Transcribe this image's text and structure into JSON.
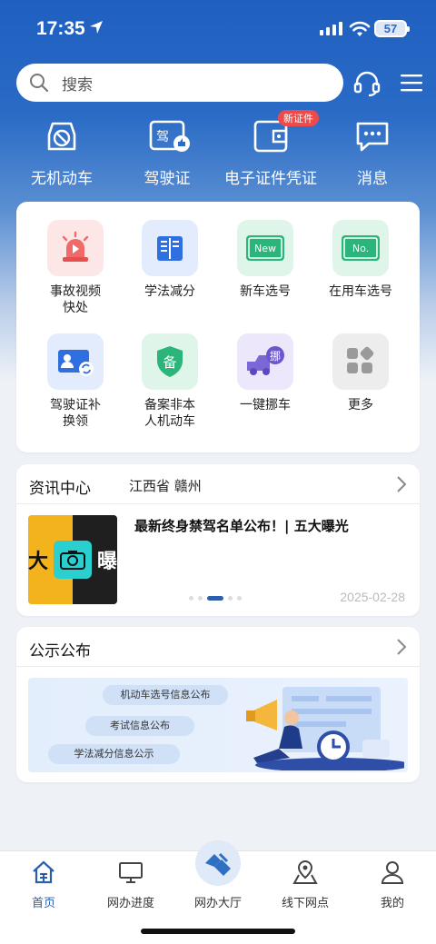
{
  "status": {
    "time": "17:35",
    "battery": "57"
  },
  "search": {
    "placeholder": "搜索"
  },
  "quick": [
    {
      "label": "无机动车"
    },
    {
      "label": "驾驶证"
    },
    {
      "label": "电子证件凭证",
      "badge": "新证件"
    },
    {
      "label": "消息"
    }
  ],
  "services": [
    {
      "label": "事故视频快处",
      "icon": "alarm-icon"
    },
    {
      "label": "学法减分",
      "icon": "book-icon"
    },
    {
      "label": "新车选号",
      "icon": "new-plate-icon",
      "glyph": "New"
    },
    {
      "label": "在用车选号",
      "icon": "plate-icon",
      "glyph": "No."
    },
    {
      "label": "驾驶证补换领",
      "icon": "license-renew-icon"
    },
    {
      "label": "备案非本人机动车",
      "icon": "shield-icon",
      "glyph": "备"
    },
    {
      "label": "一键挪车",
      "icon": "truck-icon",
      "glyph": "挪"
    },
    {
      "label": "更多",
      "icon": "more-icon"
    }
  ],
  "news": {
    "title": "资讯中心",
    "region": "江西省 赣州",
    "headline": "最新终身禁驾名单公布！| 五大曝光",
    "date": "2025-02-28",
    "thumb_left": "大",
    "thumb_right": "曝"
  },
  "notice": {
    "title": "公示公布",
    "pills": [
      "机动车选号信息公布",
      "考试信息公布",
      "学法减分信息公示"
    ]
  },
  "nav": [
    {
      "label": "首页",
      "active": true
    },
    {
      "label": "网办进度"
    },
    {
      "label": "网办大厅"
    },
    {
      "label": "线下网点"
    },
    {
      "label": "我的"
    }
  ],
  "colors": {
    "brand": "#2a6bc6",
    "accent_red": "#ef4a4a",
    "green": "#2bb57a"
  }
}
